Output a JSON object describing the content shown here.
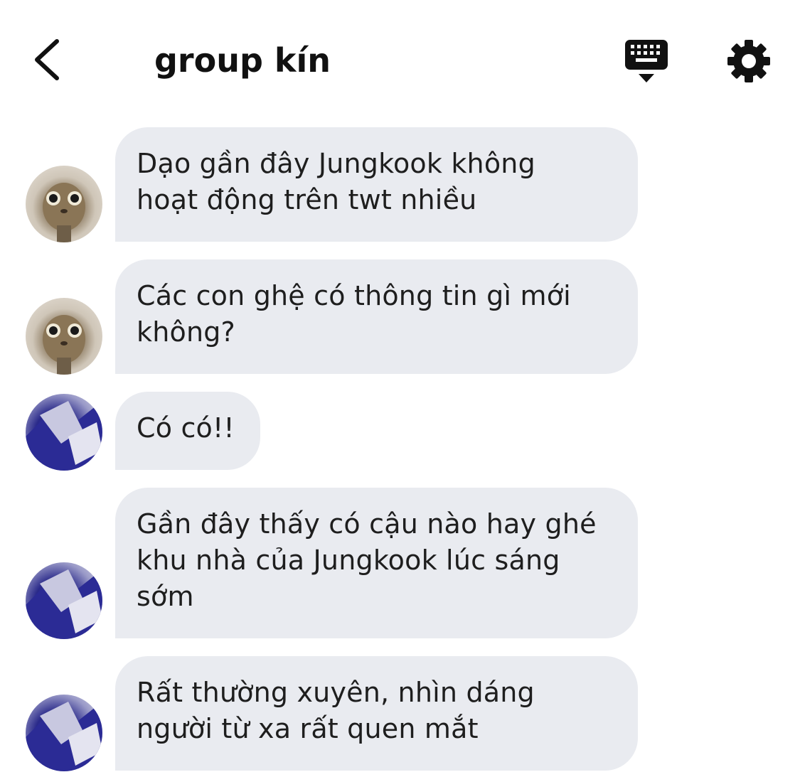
{
  "header": {
    "title": "group kín",
    "back_icon": "chevron-left-icon",
    "keyboard_icon": "keyboard-hide-icon",
    "settings_icon": "gear-icon"
  },
  "messages": [
    {
      "sender": "cat-avatar",
      "text": "Dạo gần đây Jungkook không\nhoạt động trên twt nhiều"
    },
    {
      "sender": "cat-avatar",
      "text": "Các con ghệ có thông tin gì mới\nkhông?"
    },
    {
      "sender": "anime-avatar",
      "text": "Có có!!"
    },
    {
      "sender": "anime-avatar",
      "text": "Gần đây thấy có cậu nào hay ghé\nkhu nhà của Jungkook lúc sáng\nsớm"
    },
    {
      "sender": "anime-avatar",
      "text": "Rất thường xuyên, nhìn dáng\nngười từ xa rất quen mắt"
    }
  ],
  "colors": {
    "bubble_bg": "#e9ebf0",
    "text": "#1e1e1e",
    "background": "#ffffff"
  }
}
